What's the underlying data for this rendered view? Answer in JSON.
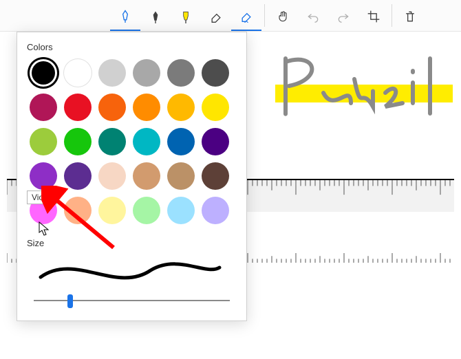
{
  "toolbar": {
    "tools": [
      {
        "name": "ballpoint",
        "active": false
      },
      {
        "name": "pencil",
        "active": false
      },
      {
        "name": "highlighter",
        "active": false
      },
      {
        "name": "eraser-soft",
        "active": false
      },
      {
        "name": "eraser-hard",
        "active": true
      }
    ]
  },
  "panel": {
    "colors_label": "Colors",
    "size_label": "Size",
    "tooltip": "Violet",
    "colors": [
      [
        "#000000",
        "#ffffff",
        "#d0d0d0",
        "#a8a8a8",
        "#7b7b7b",
        "#4d4d4d"
      ],
      [
        "#b01657",
        "#e81123",
        "#f7630c",
        "#ff8c00",
        "#ffb900",
        "#ffe600"
      ],
      [
        "#9ccc3c",
        "#16c60c",
        "#008272",
        "#00b7c3",
        "#0063b1",
        "#4b0082"
      ],
      [
        "#8e2ec6",
        "#5c2d91",
        "#f7d7c4",
        "#d29b6e",
        "#bb9167",
        "#5d4037"
      ],
      [
        "#ff66ff",
        "#ffb186",
        "#fff59d",
        "#a5f5a5",
        "#9be1ff",
        "#bdb0ff"
      ]
    ],
    "selected": [
      0,
      0
    ]
  },
  "drawing": {
    "handwritten_text": "Pencil",
    "highlighter_color": "#ffed00"
  },
  "slider": {
    "position_percent": 18
  }
}
